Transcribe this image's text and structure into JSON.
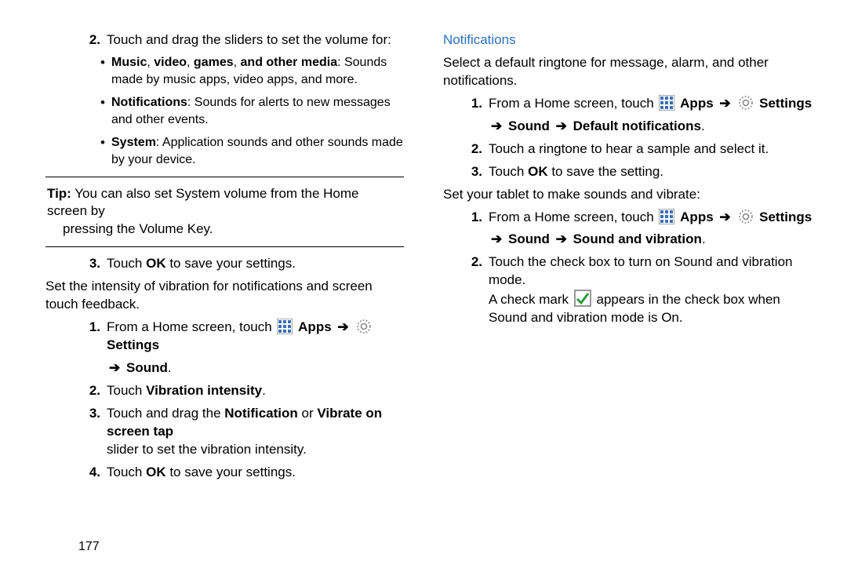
{
  "left": {
    "step2_intro": "Touch and drag the sliders to set the volume for:",
    "bullets": [
      {
        "bold": "Music",
        "rest": ", ",
        "bold2": "video",
        "rest2": ", ",
        "bold3": "games",
        "rest3": ", ",
        "bold4": "and other media",
        "desc": ": Sounds made by music apps, video apps, and more."
      },
      {
        "bold": "Notifications",
        "desc": ": Sounds for alerts to new messages and other events."
      },
      {
        "bold": "System",
        "desc": ": Application sounds and other sounds made by your device."
      }
    ],
    "tip_label": "Tip:",
    "tip_text": "You can also set System volume from the Home screen by",
    "tip_text2": "pressing the Volume Key.",
    "step3_pre": "Touch ",
    "step3_ok": "OK",
    "step3_post": " to save your settings.",
    "vib_intro": "Set the intensity of vibration for notifications and screen touch feedback.",
    "v1_pre": "From a Home screen, touch ",
    "apps": "Apps",
    "settings": "Settings",
    "sound": "Sound",
    "v2_pre": "Touch ",
    "v2_bold": "Vibration intensity",
    "v2_post": ".",
    "v3_pre": "Touch and drag the ",
    "v3_b1": "Notification",
    "v3_mid": " or ",
    "v3_b2": "Vibrate on screen tap",
    "v3_post": "slider to set the vibration intensity.",
    "v4_pre": "Touch ",
    "v4_ok": "OK",
    "v4_post": " to save your settings."
  },
  "right": {
    "heading": "Notifications",
    "intro": "Select a default ringtone for message, alarm, and other notifications.",
    "n1_pre": "From a Home screen, touch ",
    "apps": "Apps",
    "settings": "Settings",
    "sound": "Sound",
    "defnot": "Default notifications",
    "n2": "Touch a ringtone to hear a sample and select it.",
    "n3_pre": "Touch ",
    "n3_ok": "OK",
    "n3_post": " to save the setting.",
    "sv_intro": "Set your tablet to make sounds and vibrate:",
    "svib": "Sound and vibration",
    "s2": "Touch the check box to turn on Sound and vibration mode.",
    "s2b_pre": "A check mark ",
    "s2b_post": " appears in the check box when Sound and vibration mode is On."
  },
  "page_number": "177"
}
